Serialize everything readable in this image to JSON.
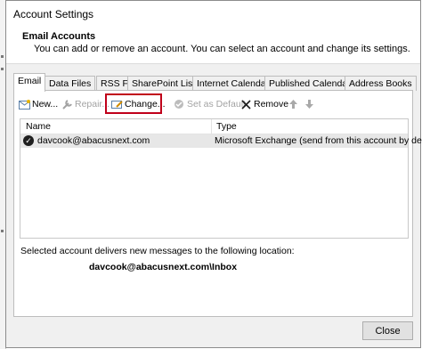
{
  "window": {
    "title": "Account Settings"
  },
  "header": {
    "heading": "Email Accounts",
    "description": "You can add or remove an account. You can select an account and change its settings."
  },
  "tabs": [
    {
      "label": "Email",
      "active": true
    },
    {
      "label": "Data Files"
    },
    {
      "label": "RSS Feeds"
    },
    {
      "label": "SharePoint Lists"
    },
    {
      "label": "Internet Calendars"
    },
    {
      "label": "Published Calendars"
    },
    {
      "label": "Address Books"
    }
  ],
  "toolbar": {
    "new_label": "New...",
    "repair_label": "Repair...",
    "change_label": "Change...",
    "default_label": "Set as Default",
    "remove_label": "Remove"
  },
  "list": {
    "columns": [
      "Name",
      "Type"
    ],
    "rows": [
      {
        "name": "davcook@abacusnext.com",
        "type": "Microsoft Exchange (send from this account by def..."
      }
    ]
  },
  "delivery": {
    "note": "Selected account delivers new messages to the following location:",
    "location": "davcook@abacusnext.com\\Inbox"
  },
  "footer": {
    "close_label": "Close"
  },
  "colors": {
    "highlight": "#c0001a",
    "selected_row": "#e7e7e7",
    "remove_x": "#1a1a1a"
  }
}
